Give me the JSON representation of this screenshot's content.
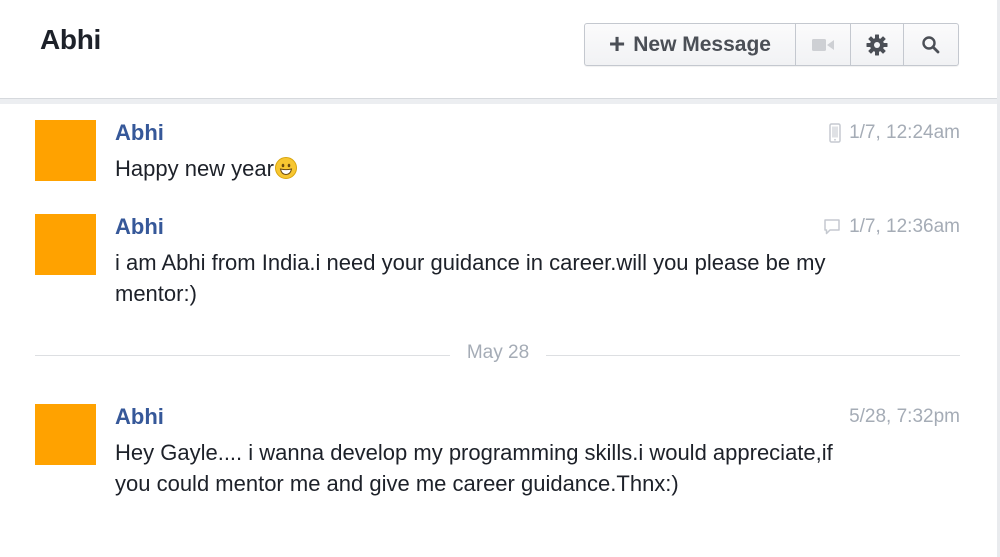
{
  "header": {
    "title": "Abhi",
    "new_message_label": "New Message",
    "icons": [
      "plus-icon",
      "video-call-icon",
      "gear-icon",
      "search-icon"
    ]
  },
  "messages": [
    {
      "sender": "Abhi",
      "text": "Happy new year",
      "emoji": "grinning-face-emoji",
      "time": "1/7, 12:24am",
      "meta_icon": "mobile-phone-icon"
    },
    {
      "sender": "Abhi",
      "text": "i am Abhi from India.i need your guidance in career.will you please be my mentor:)",
      "time": "1/7, 12:36am",
      "meta_icon": "chat-bubble-icon"
    },
    {
      "sender": "Abhi",
      "text": "Hey Gayle.... i wanna develop my programming skills.i would appreciate,if you could mentor me and give me career guidance.Thnx:)",
      "time": "5/28, 7:32pm"
    }
  ],
  "date_divider": "May 28",
  "colors": {
    "avatar": "#ffa200",
    "sender_name": "#365899",
    "timestamp": "#a5acb6",
    "text": "#1d2129"
  }
}
